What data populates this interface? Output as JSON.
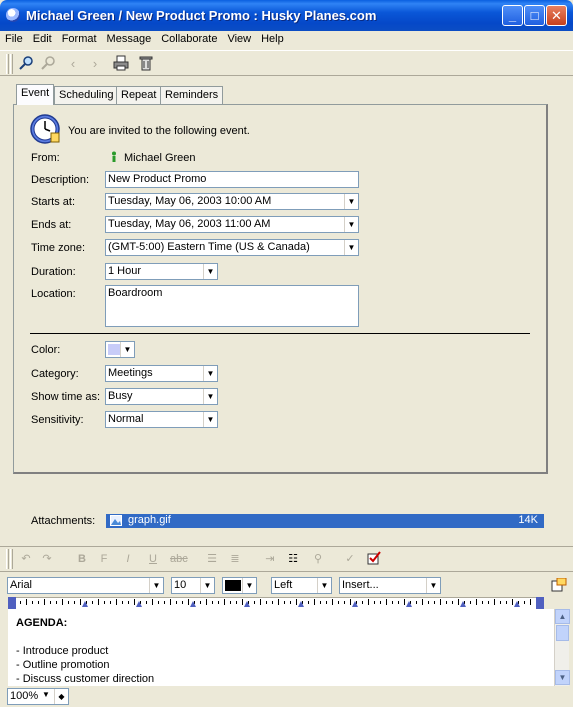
{
  "window": {
    "title": "Michael Green / New Product Promo : Husky Planes.com",
    "minimize": "_",
    "maximize": "□",
    "close": "✕"
  },
  "menu": [
    "File",
    "Edit",
    "Format",
    "Message",
    "Collaborate",
    "View",
    "Help"
  ],
  "tabs": [
    "Event",
    "Scheduling",
    "Repeat",
    "Reminders"
  ],
  "event": {
    "invite_text": "You are invited to the following event.",
    "from_label": "From:",
    "from_value": "Michael Green",
    "description_label": "Description:",
    "description_value": "New Product Promo",
    "starts_label": "Starts at:",
    "starts_value": "Tuesday, May 06, 2003 10:00 AM",
    "ends_label": "Ends at:",
    "ends_value": "Tuesday, May 06, 2003 11:00 AM",
    "timezone_label": "Time zone:",
    "timezone_value": "(GMT-5:00) Eastern Time (US & Canada)",
    "duration_label": "Duration:",
    "duration_value": "1 Hour",
    "location_label": "Location:",
    "location_value": "Boardroom",
    "color_label": "Color:",
    "color_value": "#c8ccf8",
    "category_label": "Category:",
    "category_value": "Meetings",
    "showtime_label": "Show time as:",
    "showtime_value": "Busy",
    "sensitivity_label": "Sensitivity:",
    "sensitivity_value": "Normal"
  },
  "attachments": {
    "label": "Attachments:",
    "file_name": "graph.gif",
    "file_size": "14K"
  },
  "format_bar": {
    "font": "Arial",
    "size": "10",
    "align": "Left",
    "insert": "Insert..."
  },
  "body_text": {
    "heading": "AGENDA:",
    "lines": [
      "- Introduce product",
      "- Outline promotion",
      "- Discuss customer direction"
    ]
  },
  "zoom": "100%",
  "colors": {
    "title_bar": "#0a57d8",
    "selection": "#316ac5",
    "background": "#ece9d8"
  }
}
